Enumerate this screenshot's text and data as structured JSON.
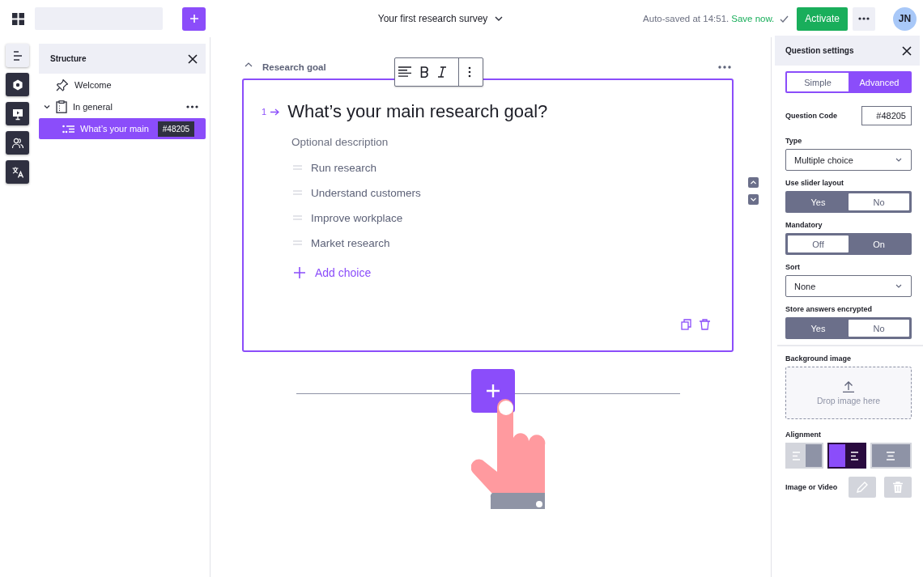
{
  "topbar": {
    "survey_title": "Your first research survey",
    "autosave": "Auto-saved at 14:51.",
    "save_link": "Save now.",
    "activate": "Activate",
    "avatar": "JN"
  },
  "rail": [
    {
      "kind": "structure",
      "selected": true
    },
    {
      "kind": "settings",
      "selected": false
    },
    {
      "kind": "presentation",
      "selected": false
    },
    {
      "kind": "people",
      "selected": false
    },
    {
      "kind": "translate",
      "selected": false
    }
  ],
  "structure": {
    "title": "Structure",
    "items": [
      {
        "kind": "welcome",
        "label": "Welcome",
        "selected": false
      },
      {
        "kind": "group",
        "label": "In general",
        "expanded": true,
        "selected": false,
        "children": [
          {
            "kind": "question",
            "label": "What’s your main",
            "code": "#48205",
            "selected": true
          }
        ]
      }
    ]
  },
  "section": {
    "title": "Research goal",
    "expanded": true
  },
  "question": {
    "number": "1",
    "title": "What’s your main research goal?",
    "description_placeholder": "Optional description",
    "choices": [
      "Run research",
      "Understand customers",
      "Improve workplace",
      "Market research"
    ],
    "add_choice": "Add choice"
  },
  "settings": {
    "title": "Question settings",
    "mode_tabs": [
      {
        "label": "Simple",
        "selected": false
      },
      {
        "label": "Advanced",
        "selected": true
      }
    ],
    "fields": [
      {
        "kind": "text",
        "label": "Question Code",
        "value": "#48205"
      },
      {
        "kind": "select",
        "label": "Type",
        "value": "Multiple choice"
      },
      {
        "kind": "toggle",
        "label": "Use slider layout",
        "options": [
          {
            "label": "Yes",
            "selected": true
          },
          {
            "label": "No",
            "selected": false
          }
        ]
      },
      {
        "kind": "toggle",
        "label": "Mandatory",
        "options": [
          {
            "label": "Off",
            "selected": false
          },
          {
            "label": "On",
            "selected": true
          }
        ]
      },
      {
        "kind": "select",
        "label": "Sort",
        "value": "None"
      },
      {
        "kind": "toggle",
        "label": "Store answers encrypted",
        "options": [
          {
            "label": "Yes",
            "selected": true
          },
          {
            "label": "No",
            "selected": false
          }
        ]
      }
    ],
    "background_image": {
      "label": "Background image",
      "drop_text": "Drop image here"
    },
    "alignment": {
      "label": "Alignment",
      "options": [
        {
          "kind": "text-left",
          "selected": false
        },
        {
          "kind": "image-left",
          "selected": true
        },
        {
          "kind": "centered",
          "selected": false
        }
      ]
    },
    "media": {
      "label": "Image or Video",
      "buttons": [
        {
          "kind": "edit",
          "disabled": true
        },
        {
          "kind": "delete",
          "disabled": true
        }
      ]
    }
  }
}
